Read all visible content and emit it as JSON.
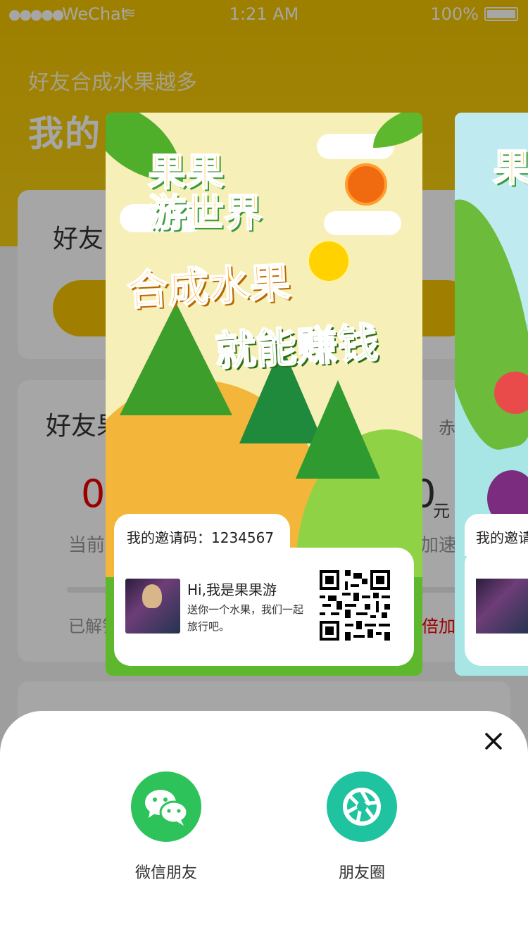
{
  "status_bar": {
    "carrier": "WeChat",
    "time": "1:21 AM",
    "battery": "100%"
  },
  "background": {
    "hero_subtitle": "好友合成水果越多",
    "hero_title": "我的",
    "card1_title": "好友",
    "card2_title": "好友果",
    "card2_rule": "赤规则",
    "big_number": "0",
    "right_number": "0",
    "unit_yuan": "元",
    "label_left": "当前",
    "label_right": "加速",
    "unlocked_label": "已解锁",
    "speed_label": "倍加速"
  },
  "poster": {
    "logo_text": "果果\n游世界",
    "slogan_line1": "合成水果",
    "slogan_line2": "就能赚钱",
    "invite_code_label": "我的邀请码：1234567",
    "greeting": "Hi,我是果果游",
    "greeting_desc": "送你一个水果，我们一起旅行吧。"
  },
  "poster_next": {
    "invite_code_label": "我的邀请"
  },
  "share_sheet": {
    "options": [
      {
        "label": "微信朋友",
        "icon": "wechat-icon",
        "color": "#2dc35a"
      },
      {
        "label": "朋友圈",
        "icon": "moments-icon",
        "color": "#20c39f"
      }
    ]
  }
}
